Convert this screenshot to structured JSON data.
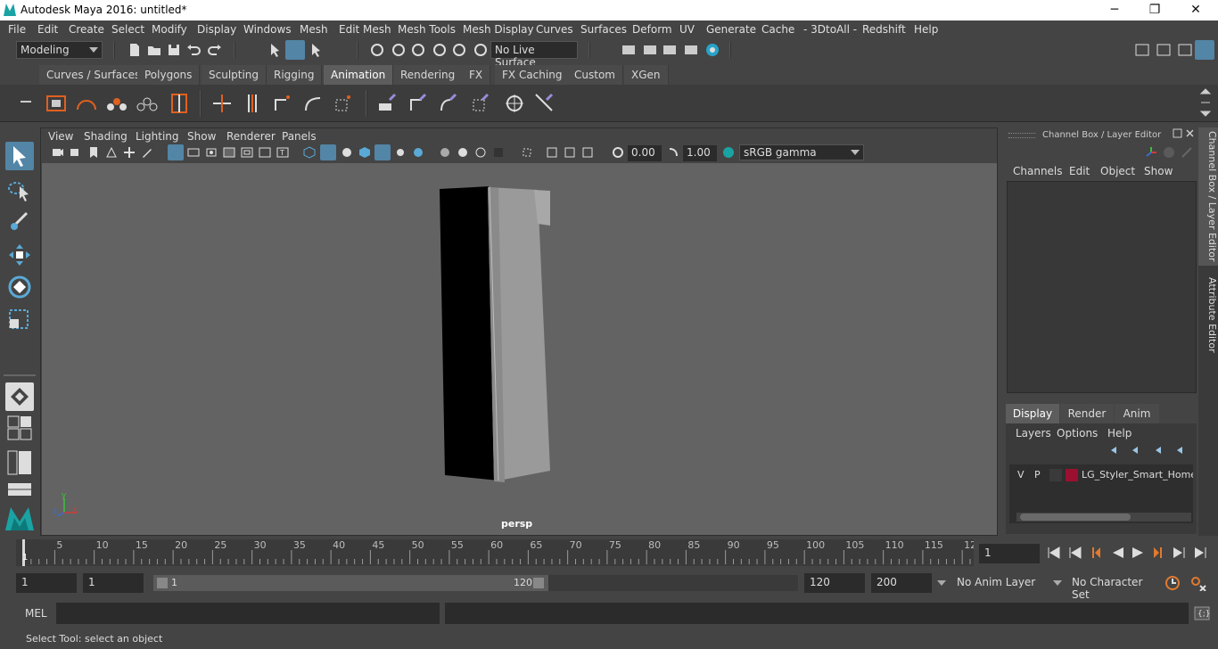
{
  "window": {
    "title": "Autodesk Maya 2016: untitled*",
    "controls": [
      "─",
      "❐",
      "✕"
    ]
  },
  "menubar": {
    "items": [
      "File",
      "Edit",
      "Create",
      "Select",
      "Modify",
      "Display",
      "Windows",
      "Mesh",
      "Edit Mesh",
      "Mesh Tools",
      "Mesh Display",
      "Curves",
      "Surfaces",
      "Deform",
      "UV",
      "Generate",
      "Cache",
      "- 3DtoAll -",
      "Redshift",
      "Help"
    ]
  },
  "statusline": {
    "mode": "Modeling",
    "live_surface": "No Live Surface"
  },
  "shelf": {
    "tabs": [
      "Curves / Surfaces",
      "Polygons",
      "Sculpting",
      "Rigging",
      "Animation",
      "Rendering",
      "FX",
      "FX Caching",
      "Custom",
      "XGen"
    ],
    "active_tab": "Animation"
  },
  "viewport": {
    "menu": [
      "View",
      "Shading",
      "Lighting",
      "Show",
      "Renderer",
      "Panels"
    ],
    "exposure": "0.00",
    "gamma": "1.00",
    "color_space": "sRGB gamma",
    "camera_label": "persp",
    "axis": {
      "x": "x",
      "y": "y",
      "z": "z"
    }
  },
  "channel_box": {
    "title": "Channel Box / Layer Editor",
    "menu": [
      "Channels",
      "Edit",
      "Object",
      "Show"
    ],
    "layer_tabs": [
      "Display",
      "Render",
      "Anim"
    ],
    "active_layer_tab": "Display",
    "layer_menu": [
      "Layers",
      "Options",
      "Help"
    ],
    "layers": [
      {
        "v": "V",
        "p": "P",
        "color": "#9b1030",
        "name": "LG_Styler_Smart_Home_S"
      }
    ]
  },
  "side_tabs": [
    "Channel Box / Layer Editor",
    "Attribute Editor"
  ],
  "timeline": {
    "ticks": [
      "5",
      "10",
      "15",
      "20",
      "25",
      "30",
      "35",
      "40",
      "45",
      "50",
      "55",
      "60",
      "65",
      "70",
      "75",
      "80",
      "85",
      "90",
      "95",
      "100",
      "105",
      "110",
      "115",
      "12"
    ],
    "start_marker": "1",
    "current_frame": "1"
  },
  "range": {
    "start": "1",
    "playback_start": "1",
    "slider_start": "1",
    "slider_end": "120",
    "playback_end": "120",
    "end": "200",
    "anim_layer": "No Anim Layer",
    "character_set": "No Character Set"
  },
  "command_line": {
    "label": "MEL"
  },
  "help_line": {
    "text": "Select Tool: select an object"
  }
}
